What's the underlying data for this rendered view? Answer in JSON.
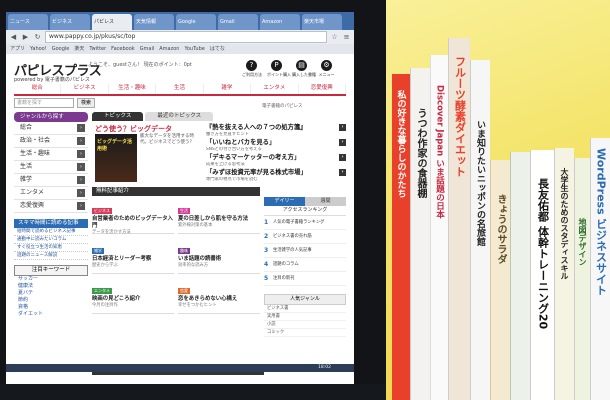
{
  "browser": {
    "tabs": [
      "ニュース",
      "ビジネス",
      "パピレス",
      "天気情報",
      "Google",
      "Gmail",
      "Amazon",
      "楽天市場"
    ],
    "active_tab_index": 2,
    "url": "www.pappy.co.jp/pkus/sc/top",
    "bookmarks": [
      "アプリ",
      "Yahoo!",
      "Google",
      "楽天",
      "Twitter",
      "Facebook",
      "Gmail",
      "Amazon",
      "YouTube",
      "はてな"
    ]
  },
  "site": {
    "logo": "パピレスプラス",
    "logo_sub": "powered by 電子書籍のパピレス",
    "welcome": "ようこそ、guestさん！ 現在のポイント：0pt",
    "header_icons": [
      {
        "icon": "help-icon",
        "label": "ご利用方法"
      },
      {
        "icon": "points-icon",
        "label": "ポイント購入"
      },
      {
        "icon": "cart-icon",
        "label": "購入した書籍"
      },
      {
        "icon": "gear-icon",
        "label": "メニュー"
      }
    ],
    "nav": [
      "総合",
      "ビジネス",
      "生活・趣味",
      "生活",
      "雑学",
      "エンタメ",
      "恋愛復興"
    ],
    "search_placeholder": "書籍を探す",
    "search_button": "検索",
    "breadcrumb": "電子書籍のパピレス"
  },
  "sidebar": {
    "heading": "ジャンルから探す",
    "items": [
      "総合",
      "政治・社会",
      "生活・趣味",
      "生活",
      "雑学",
      "エンタメ",
      "恋愛復興"
    ],
    "promo_heading": "スキマ時間に読める記事",
    "promo_lines": [
      "短時間で読めるビジネス記事",
      "通勤中に読みたいコラム",
      "すぐ役立つ生活の知恵",
      "話題のニュース解説"
    ],
    "keyword_heading": "注目キーワード",
    "keywords": [
      "サッカー",
      "健康法",
      "夏バテ",
      "節約",
      "資格",
      "ダイエット"
    ]
  },
  "topics": {
    "tabs": [
      "トピックス",
      "最近のトピックス"
    ],
    "feature_title": "どう使う？ビッグデータ",
    "feature_image_caption": "ビッグデータ活用術",
    "feature_text": "膨大なデータを活用する時代。ビジネスでどう使う？",
    "headlines": [
      {
        "title": "『熱を抜える人への７つの処方箋』",
        "sub": "働き方を見直すヒント"
      },
      {
        "title": "「いいねとバカを見る」",
        "sub": "SNSとの付き合い方を考える"
      },
      {
        "title": "「デキるマーケッターの考え方」",
        "sub": "成果を上げる思考法"
      },
      {
        "title": "「みずほ投資元率が見る株式市場」",
        "sub": "専門家の視点で市場を読む"
      }
    ]
  },
  "free_section": {
    "heading": "無料記事紹介",
    "cells": [
      {
        "badge": "ビジネス",
        "title": "自営業者のためのビッグデータ入門",
        "sub": "データを活かす方法"
      },
      {
        "badge": "生活",
        "title": "夏の日差しから肌を守る方法",
        "sub": "紫外線対策の基本"
      },
      {
        "badge": "雑学",
        "title": "日本経済とリーダー考察",
        "sub": "歴史から学ぶ"
      },
      {
        "badge": "趣味",
        "title": "いま話題の読書術",
        "sub": "効率的な読み方"
      },
      {
        "badge": "エンタメ",
        "title": "映画の見どころ紹介",
        "sub": "今月の注目作"
      },
      {
        "badge": "恋愛",
        "title": "恋をあきらめない心構え",
        "sub": "幸せをつかむヒント"
      }
    ]
  },
  "ranking": {
    "tabs": [
      "デイリー",
      "週間"
    ],
    "label": "アクセスランキング",
    "items": [
      "人気の電子書籍ランキング",
      "ビジネス書の売れ筋",
      "生活雑学の人気記事",
      "話題のコラム",
      "注目の新刊"
    ]
  },
  "genres": {
    "heading": "人気ジャンル",
    "items": [
      "ビジネス書",
      "実用書",
      "小説",
      "コミック"
    ]
  },
  "pickup": "PICK UP",
  "clock": "18:02",
  "books": [
    {
      "title": "私の好きな暮らしのかたち"
    },
    {
      "title": "うつわ作家の食器棚"
    },
    {
      "title": "Discover Japan いま話題の日本"
    },
    {
      "title": "フルーツ酵素ダイエット"
    },
    {
      "title": "いま知りたいニッポンの名旅館"
    },
    {
      "title": "きょうのサラダ"
    },
    {
      "title": "長友佑都 体幹トレーニング20"
    },
    {
      "title": "大学生のためのスタディスキル"
    },
    {
      "title": "地図デザイン"
    },
    {
      "title": "WordPress ビジネスサイト"
    }
  ]
}
